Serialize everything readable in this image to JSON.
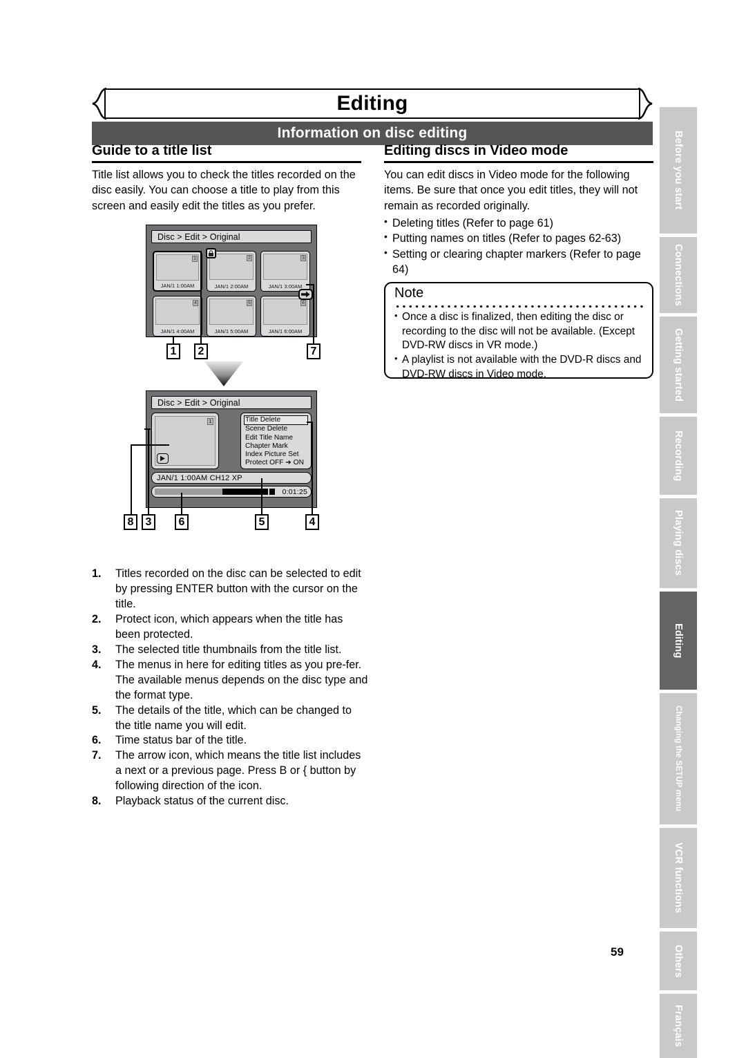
{
  "page": {
    "chapter_title": "Editing",
    "section_title": "Information on disc editing",
    "page_number": "59"
  },
  "left_column": {
    "heading": "Guide to a title list",
    "paragraph": "Title list allows you to check the titles recorded on the disc easily. You can choose a title to play from this screen and easily edit the titles as you prefer."
  },
  "right_column": {
    "heading": "Editing discs in Video mode",
    "paragraph": "You can edit discs in Video mode for the following items. Be sure that once you edit titles, they will not remain as recorded originally.",
    "bullets": [
      "Deleting titles (Refer to page 61)",
      "Putting names on titles (Refer to pages 62-63)",
      "Setting or clearing chapter markers (Refer to page 64)"
    ]
  },
  "note": {
    "title": "Note",
    "bullets": [
      "Once a disc is finalized, then editing the disc or recording to the disc will not be available. (Except DVD-RW discs in VR mode.)",
      "A playlist is not available with the DVD-R discs and DVD-RW discs in Video mode."
    ]
  },
  "title_list_screen": {
    "breadcrumb": "Disc > Edit > Original",
    "thumbnails": [
      {
        "index": "1",
        "stamp": "JAN/1  1:00AM",
        "selected": true,
        "protected": false
      },
      {
        "index": "2",
        "stamp": "JAN/1  2:00AM",
        "selected": false,
        "protected": true
      },
      {
        "index": "3",
        "stamp": "JAN/1  3:00AM",
        "selected": false,
        "protected": false
      },
      {
        "index": "4",
        "stamp": "JAN/1  4:00AM",
        "selected": false,
        "protected": false
      },
      {
        "index": "5",
        "stamp": "JAN/1  5:00AM",
        "selected": false,
        "protected": false
      },
      {
        "index": "6",
        "stamp": "JAN/1  6:00AM",
        "selected": false,
        "protected": false
      }
    ],
    "protect_icon_glyph": "⬛",
    "next_page_arrow_glyph": "➡",
    "callouts": [
      "1",
      "2",
      "7"
    ]
  },
  "detail_screen": {
    "breadcrumb": "Disc > Edit > Original",
    "thumbnail_index": "1",
    "play_icon_glyph": "▶",
    "menu_items": [
      "Title Delete",
      "Scene Delete",
      "Edit Title Name",
      "Chapter Mark",
      "Index Picture Set",
      "Protect OFF ➔ ON"
    ],
    "highlighted_menu_item": "Title Delete",
    "info_line": "JAN/1  1:00AM  CH12     XP",
    "elapsed_time": "0:01:25",
    "callouts": [
      "8",
      "3",
      "6",
      "5",
      "4"
    ]
  },
  "numbered_notes": [
    {
      "num": "1.",
      "text": "Titles recorded on the disc can be selected to edit by pressing ENTER button with the cursor on the title."
    },
    {
      "num": "2.",
      "text": "Protect icon, which appears when the title has been protected."
    },
    {
      "num": "3.",
      "text": "The selected title thumbnails from the title list."
    },
    {
      "num": "4.",
      "text": "The menus in here for editing titles as you pre-fer. The available menus depends on the disc type and the format type."
    },
    {
      "num": "5.",
      "text": "The details of the title, which can be changed to the title name you will edit."
    },
    {
      "num": "6.",
      "text": "Time status bar of the title."
    },
    {
      "num": "7.",
      "text": "The arrow icon, which means the title list includes a next or a previous page. Press B or {   button by following direction of the icon."
    },
    {
      "num": "8.",
      "text": "Playback status of the current disc."
    }
  ],
  "side_tabs": [
    {
      "label": "Before you start",
      "active": false
    },
    {
      "label": "Connections",
      "active": false
    },
    {
      "label": "Getting started",
      "active": false
    },
    {
      "label": "Recording",
      "active": false
    },
    {
      "label": "Playing discs",
      "active": false
    },
    {
      "label": "Editing",
      "active": true
    },
    {
      "label": "Changing the SETUP menu",
      "active": false
    },
    {
      "label": "VCR functions",
      "active": false
    },
    {
      "label": "Others",
      "active": false
    },
    {
      "label": "Français",
      "active": false
    }
  ],
  "colors": {
    "section_bar": "#555557",
    "tab_inactive": "#c8c9ca",
    "tab_active": "#636466",
    "screen_bg": "#6f7173",
    "screen_panel": "#d9dadb"
  }
}
